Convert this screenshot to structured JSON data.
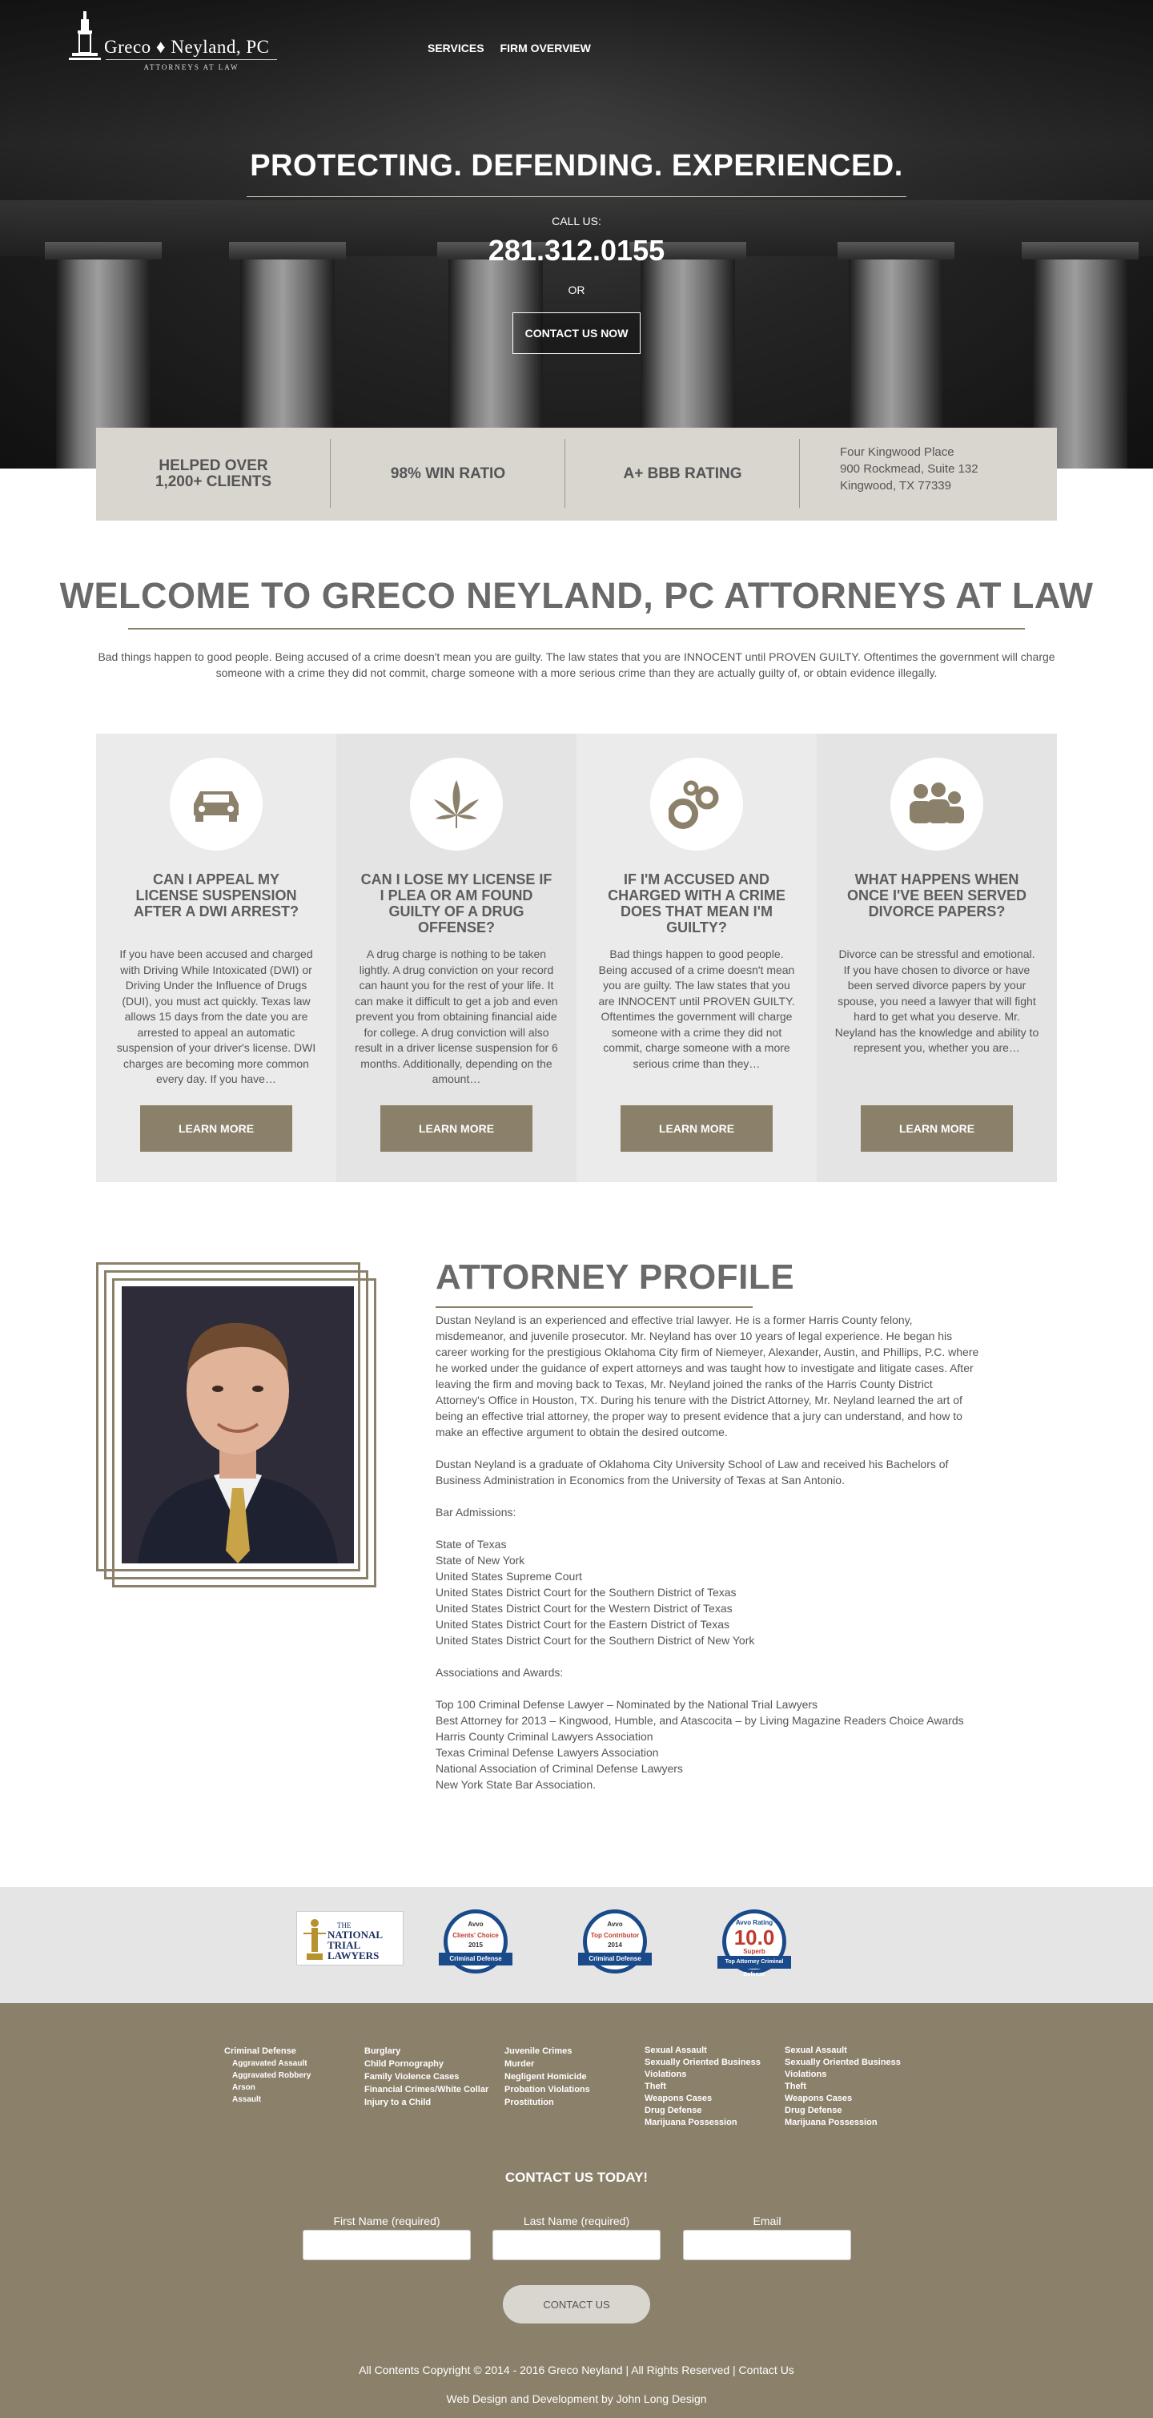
{
  "brand": {
    "name": "Greco ♦ Neyland, PC",
    "tagline": "ATTORNEYS AT LAW",
    "icon": "courthouse-tower-icon",
    "accent_color": "#8b806a"
  },
  "nav": {
    "items": [
      {
        "label": "SERVICES"
      },
      {
        "label": "FIRM OVERVIEW"
      }
    ]
  },
  "hero": {
    "title": "PROTECTING. DEFENDING. EXPERIENCED.",
    "call_label": "CALL US:",
    "phone": "281.312.0155",
    "or": "OR",
    "button": "CONTACT US NOW"
  },
  "stats": {
    "items": [
      {
        "line1": "HELPED OVER",
        "line2": "1,200+ CLIENTS"
      },
      {
        "line1": "98% WIN RATIO",
        "line2": ""
      },
      {
        "line1": "A+ BBB RATING",
        "line2": ""
      }
    ],
    "address": [
      "Four Kingwood Place",
      "900 Rockmead, Suite 132",
      "Kingwood, TX 77339"
    ]
  },
  "welcome": {
    "title": "WELCOME TO GRECO NEYLAND, PC ATTORNEYS AT LAW",
    "text": "Bad things happen to good people. Being accused of a crime doesn't mean you are guilty. The law states that you are INNOCENT until PROVEN GUILTY. Oftentimes the government will charge someone with a crime they did not commit, charge someone with a more serious crime than they are actually guilty of, or obtain evidence illegally."
  },
  "cards": [
    {
      "icon": "car-icon",
      "title": "CAN I APPEAL MY LICENSE SUSPENSION AFTER A DWI ARREST?",
      "text": "If you have been accused and charged with Driving While Intoxicated (DWI) or Driving Under the Influence of Drugs (DUI), you must act quickly. Texas law allows 15 days from the date you are arrested to appeal an automatic suspension of your driver's license. DWI charges are becoming more common every day. If you have…",
      "button": "LEARN MORE"
    },
    {
      "icon": "cannabis-leaf-icon",
      "title": "CAN I LOSE MY LICENSE IF I PLEA OR AM FOUND GUILTY OF A DRUG OFFENSE?",
      "text": "A drug charge is nothing to be taken lightly. A drug conviction on your record can haunt you for the rest of your life. It can make it difficult to get a job and even prevent you from obtaining financial aide for college. A drug conviction will also result in a driver license suspension for 6 months. Additionally, depending on the amount…",
      "button": "LEARN MORE"
    },
    {
      "icon": "handcuffs-icon",
      "title": "IF I'M ACCUSED AND CHARGED WITH A CRIME DOES THAT MEAN I'M GUILTY?",
      "text": "Bad things happen to good people. Being accused of a crime doesn't mean you are guilty. The law states that you are INNOCENT until PROVEN GUILTY. Oftentimes the government will charge someone with a crime they did not commit, charge someone with a more serious crime than they…",
      "button": "LEARN MORE"
    },
    {
      "icon": "family-icon",
      "title": "WHAT HAPPENS WHEN ONCE I'VE BEEN SERVED DIVORCE PAPERS?",
      "text": "Divorce can be stressful and emotional. If you have chosen to divorce or have been served divorce papers by your spouse, you need a lawyer that will fight hard to get what you deserve. Mr. Neyland has the knowledge and ability to represent you, whether you are…",
      "button": "LEARN MORE"
    }
  ],
  "profile": {
    "title": "ATTORNEY PROFILE",
    "bio": "Dustan Neyland is an experienced and effective trial lawyer. He is a former Harris County felony, misdemeanor, and juvenile prosecutor. Mr. Neyland has over 10 years of legal experience. He began his career working for the prestigious Oklahoma City firm of Niemeyer, Alexander, Austin, and Phillips, P.C. where he worked under the guidance of expert attorneys and was taught how to investigate and litigate cases. After leaving the firm and moving back to Texas, Mr. Neyland joined the ranks of the Harris County District Attorney's Office in Houston, TX. During his tenure with the District Attorney, Mr. Neyland learned the art of being an effective trial attorney, the proper way to present evidence that a jury can understand, and how to make an effective argument to obtain the desired outcome.",
    "education": "Dustan Neyland is a graduate of Oklahoma City University School of Law and received his Bachelors of Business Administration in Economics from the University of Texas at San Antonio.",
    "admissions_label": "Bar Admissions:",
    "admissions": [
      "State of Texas",
      "State of New York",
      "United States Supreme Court",
      "United States District Court for the Southern District of Texas",
      "United States District Court for the Western District of Texas",
      "United States District Court for the Eastern District of Texas",
      "United States District Court for the Southern District of New York"
    ],
    "awards_label": "Associations and Awards:",
    "awards": [
      "Top 100 Criminal Defense Lawyer – Nominated by the National Trial Lawyers",
      "Best Attorney for 2013 – Kingwood, Humble, and Atascocita – by Living Magazine Readers Choice Awards",
      "Harris County Criminal Lawyers Association",
      "Texas Criminal Defense Lawyers Association",
      "National Association of Criminal Defense Lawyers",
      "New York State Bar Association."
    ]
  },
  "badges": {
    "ntl": {
      "top": "THE",
      "main1": "NATIONAL",
      "main2": "TRIAL LAWYERS"
    },
    "avvo1": {
      "brand": "Avvo",
      "line1": "Clients' Choice",
      "line2": "2015",
      "ribbon": "Criminal Defense"
    },
    "avvo2": {
      "brand": "Avvo",
      "line1": "Top Contributor",
      "line2": "2014",
      "ribbon": "Criminal Defense"
    },
    "avvo3": {
      "brand": "Avvo Rating",
      "score": "10.0",
      "line1": "Superb",
      "ribbon": "Top Attorney Criminal Defense"
    }
  },
  "footer": {
    "columns": [
      {
        "title": "Criminal Defense",
        "subs": [
          "Aggravated Assault",
          "Aggravated Robbery",
          "Arson",
          "Assault"
        ],
        "items": []
      },
      {
        "title": "",
        "subs": [],
        "items": [
          "Burglary",
          "Child Pornography",
          "Family Violence Cases",
          "Financial Crimes/White Collar",
          "Injury to a Child"
        ]
      },
      {
        "title": "",
        "subs": [],
        "items": [
          "Juvenile Crimes",
          "Murder",
          "Negligent Homicide",
          "Probation Violations",
          "Prostitution"
        ]
      },
      {
        "title": "",
        "subs": [],
        "items": [
          "Sexual Assault",
          "Sexually Oriented Business Violations",
          "Theft",
          "Weapons Cases",
          "Drug Defense",
          "Marijuana Possession"
        ]
      },
      {
        "title": "",
        "subs": [],
        "items": [
          "Sexual Assault",
          "Sexually Oriented Business Violations",
          "Theft",
          "Weapons Cases",
          "Drug Defense",
          "Marijuana Possession"
        ]
      }
    ],
    "contact_title": "CONTACT US TODAY!",
    "fields": [
      {
        "label": "First Name (required)",
        "placeholder": ""
      },
      {
        "label": "Last Name (required)",
        "placeholder": ""
      },
      {
        "label": "Email",
        "placeholder": ""
      }
    ],
    "submit": "CONTACT US",
    "copyright": "All Contents Copyright © 2014 - 2016 Greco Neyland | All Rights Reserved | Contact Us",
    "credit": "Web Design and Development by John Long Design"
  }
}
